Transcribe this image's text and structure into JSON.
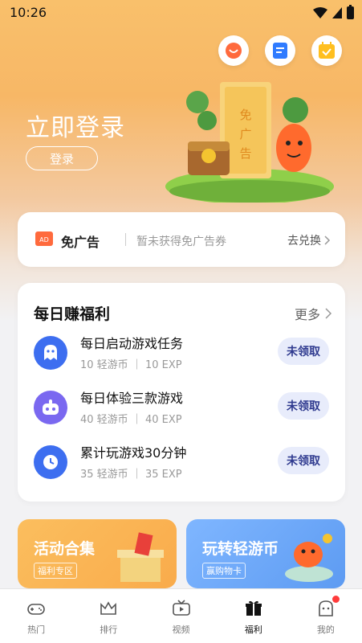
{
  "status_bar": {
    "time": "10:26"
  },
  "header": {
    "login_title": "立即登录",
    "login_button": "登录",
    "icons": [
      "orange-face-icon",
      "blue-doc-icon",
      "yellow-calendar-icon"
    ]
  },
  "hero": {
    "ticket_text": "免广告"
  },
  "no_ad": {
    "title": "免广告",
    "desc": "暂未获得免广告券",
    "action": "去兑换"
  },
  "daily": {
    "title": "每日赚福利",
    "more": "更多",
    "tasks": [
      {
        "title": "每日启动游戏任务",
        "coins": "10 轻游币",
        "exp": "10 EXP",
        "button": "未领取",
        "icon": "ghost-icon",
        "color": "#3d6ef0"
      },
      {
        "title": "每日体验三款游戏",
        "coins": "40 轻游币",
        "exp": "40 EXP",
        "button": "未领取",
        "icon": "controller-face-icon",
        "color": "#7a68f0"
      },
      {
        "title": "累计玩游戏30分钟",
        "coins": "35 轻游币",
        "exp": "35 EXP",
        "button": "未领取",
        "icon": "clock-icon",
        "color": "#3d6ef0"
      }
    ]
  },
  "promos": [
    {
      "title": "活动合集",
      "tag": "福利专区"
    },
    {
      "title": "玩转轻游币",
      "tag": "赢购物卡"
    }
  ],
  "bottom_nav": [
    {
      "label": "热门",
      "icon": "gamepad-icon"
    },
    {
      "label": "排行",
      "icon": "crown-icon"
    },
    {
      "label": "视频",
      "icon": "tv-icon"
    },
    {
      "label": "福利",
      "icon": "gift-icon",
      "active": true
    },
    {
      "label": "我的",
      "icon": "profile-icon",
      "badge": true
    }
  ],
  "colors": {
    "accent": "#f7b766",
    "button_bg": "#e8ecfb",
    "button_text": "#2f3a8f",
    "badge": "#ff3b3b"
  }
}
